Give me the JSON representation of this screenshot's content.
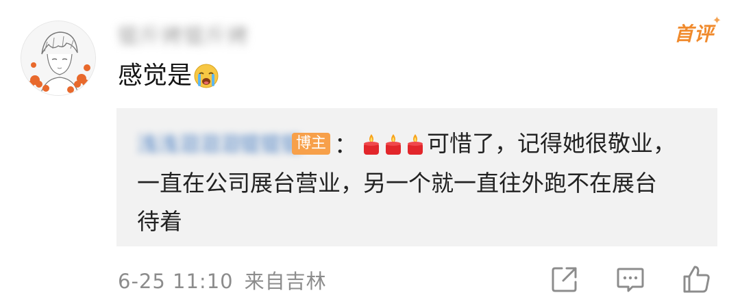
{
  "comment": {
    "author_name": "锟斤拷锟斤拷",
    "first_badge": "首评",
    "text": "感觉是",
    "emoji": "crying-face"
  },
  "reply": {
    "author_name": "浅浅泪泪泪锟锟锟",
    "author_tag": "博主",
    "colon": "：",
    "candle_emoji_count": 3,
    "text": "可惜了，记得她很敬业，一直在公司展台营业，另一个就一直往外跑不在展台待着"
  },
  "footer": {
    "date_time": "6-25 11:10",
    "location": "来自吉林"
  },
  "icons": [
    "share-icon",
    "comment-icon",
    "like-icon"
  ],
  "colors": {
    "accent": "#f08a2c",
    "link_blue": "#4a7fc2",
    "muted": "#8c8c8c",
    "reply_bg": "#f2f2f2"
  }
}
